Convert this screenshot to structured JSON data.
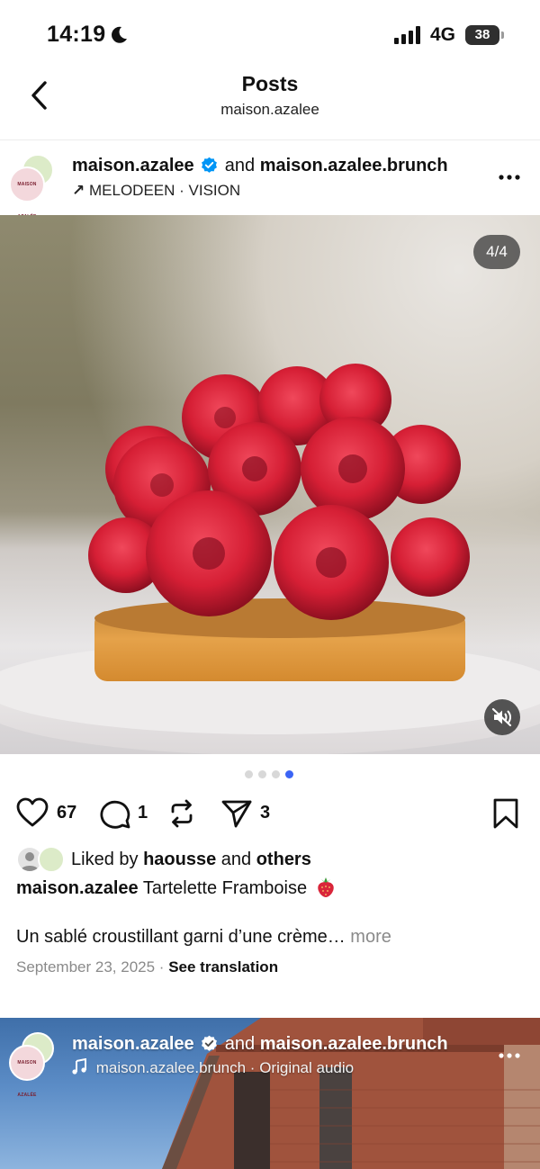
{
  "status_bar": {
    "time": "14:19",
    "network": "4G",
    "battery": "38"
  },
  "nav": {
    "title": "Posts",
    "subtitle": "maison.azalee"
  },
  "post": {
    "avatar_text": "MAISON AZALÉE",
    "author": "maison.azalee",
    "conjunction": "and",
    "coauthor": "maison.azalee.brunch",
    "audio_arrow": "↗",
    "audio": "MELODEEN · VISION",
    "image_counter": "4/4",
    "image_position": {
      "current": 4,
      "total": 4
    },
    "like_count": "67",
    "comment_count": "1",
    "share_count": "3",
    "likes_prefix": "Liked by",
    "liked_by": "haousse",
    "likes_and": "and",
    "likes_others": "others",
    "caption_author": "maison.azalee",
    "caption_title": "Tartelette Framboise",
    "caption_body": "Un sablé croustillant garni d’une crème…",
    "more_label": "more",
    "date": "September 23, 2025",
    "date_separator": "·",
    "see_translation": "See translation"
  },
  "next_post": {
    "author": "maison.azalee",
    "conjunction": "and",
    "coauthor": "maison.azalee.brunch",
    "audio_user": "maison.azalee.brunch",
    "audio_separator": "·",
    "audio_title": "Original audio"
  },
  "icons": {
    "back": "chevron-left-icon",
    "verified": "verified-badge-icon",
    "more": "more-horizontal-icon",
    "like": "heart-icon",
    "comment": "comment-icon",
    "repost": "repost-icon",
    "share": "send-icon",
    "save": "bookmark-icon",
    "mute": "speaker-muted-icon",
    "music": "music-note-icon"
  },
  "colors": {
    "verified": "#0095f6",
    "active_dot": "#3b64f5",
    "muted_text": "#8a8a8a"
  }
}
